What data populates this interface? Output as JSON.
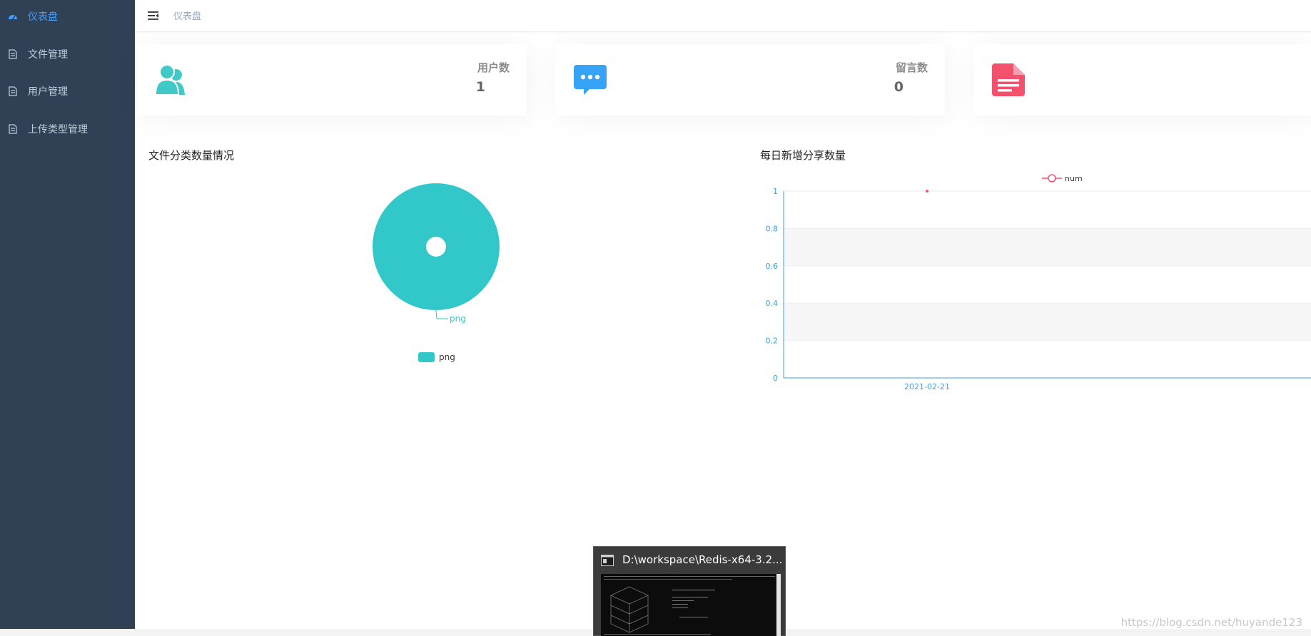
{
  "sidebar": {
    "items": [
      {
        "label": "仪表盘",
        "active": true,
        "icon": "dashboard-icon"
      },
      {
        "label": "文件管理",
        "active": false,
        "icon": "document-icon"
      },
      {
        "label": "用户管理",
        "active": false,
        "icon": "document-icon"
      },
      {
        "label": "上传类型管理",
        "active": false,
        "icon": "document-icon"
      }
    ],
    "colors": {
      "background": "#304156",
      "text": "#bfcbd9",
      "active": "#409eff"
    }
  },
  "header": {
    "breadcrumb": "仪表盘",
    "toggle_icon": "hamburger-icon"
  },
  "stats": [
    {
      "label": "用户数",
      "value": "1",
      "icon": "users-icon",
      "color": "#40c9c6"
    },
    {
      "label": "留言数",
      "value": "0",
      "icon": "message-icon",
      "color": "#36a3f7"
    },
    {
      "label": "",
      "value": "",
      "icon": "document-icon",
      "color": "#f4516c"
    }
  ],
  "pie_panel": {
    "title": "文件分类数量情况"
  },
  "line_panel": {
    "title": "每日新增分享数量"
  },
  "chart_data": [
    {
      "type": "pie",
      "title": "文件分类数量情况",
      "categories": [
        "png"
      ],
      "values": [
        1
      ],
      "colors": [
        "#32c8ca"
      ],
      "legend": "bottom-center",
      "slice_labels": [
        "png"
      ]
    },
    {
      "type": "line",
      "title": "每日新增分享数量",
      "x": [
        "2021-02-21"
      ],
      "series": [
        {
          "name": "num",
          "values": [
            1
          ],
          "color": "#f4516c"
        }
      ],
      "ylim": [
        0,
        1
      ],
      "yticks": [
        "0",
        "0.2",
        "0.4",
        "0.6",
        "0.8",
        "1"
      ],
      "legend": "top-center",
      "axis_color": "#3ba1da",
      "grid": true
    }
  ],
  "taskbar_preview": {
    "title": "D:\\workspace\\Redis-x64-3.2..."
  },
  "watermark": "https://blog.csdn.net/huyande123"
}
